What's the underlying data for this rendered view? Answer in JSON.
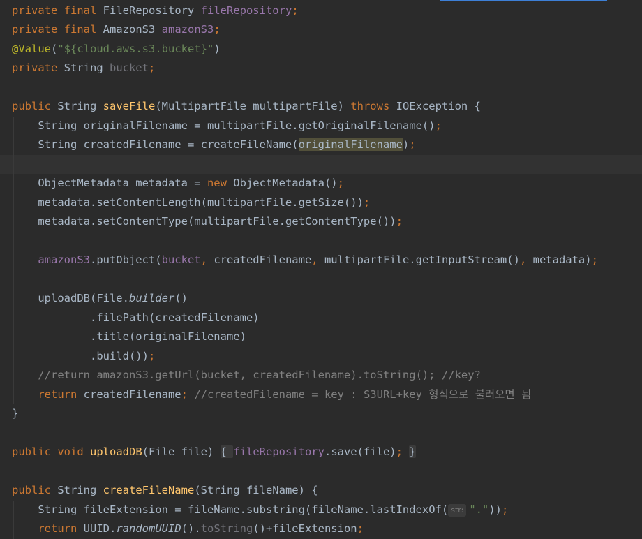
{
  "lines": [
    "private final FileRepository fileRepository;",
    "private final AmazonS3 amazonS3;",
    "@Value(\"${cloud.aws.s3.bucket}\")",
    "private String bucket;",
    "",
    "public String saveFile(MultipartFile multipartFile) throws IOException {",
    "    String originalFilename = multipartFile.getOriginalFilename();",
    "    String createdFilename = createFileName(originalFilename);",
    "",
    "    ObjectMetadata metadata = new ObjectMetadata();",
    "    metadata.setContentLength(multipartFile.getSize());",
    "    metadata.setContentType(multipartFile.getContentType());",
    "",
    "    amazonS3.putObject(bucket, createdFilename, multipartFile.getInputStream(), metadata);",
    "",
    "    uploadDB(File.builder()",
    "            .filePath(createdFilename)",
    "            .title(originalFilename)",
    "            .build());",
    "    //return amazonS3.getUrl(bucket, createdFilename).toString(); //key?",
    "    return createdFilename; //createdFilename = key : S3URL+key 형식으로 불러오면 됨",
    "}",
    "",
    "public void uploadDB(File file) { fileRepository.save(file); }",
    "",
    "public String createFileName(String fileName) {",
    "    String fileExtension = fileName.substring(fileName.lastIndexOf(str: \".\"));",
    "    return UUID.randomUUID().toString()+fileExtension;"
  ],
  "inlay_hint": "str:",
  "colors": {
    "background": "#2b2b2b",
    "keyword": "#cc7832",
    "field": "#9876aa",
    "method_declaration": "#ffc66d",
    "string": "#6a8759",
    "annotation": "#bbb529",
    "comment": "#808080",
    "default_text": "#a9b7c6"
  }
}
